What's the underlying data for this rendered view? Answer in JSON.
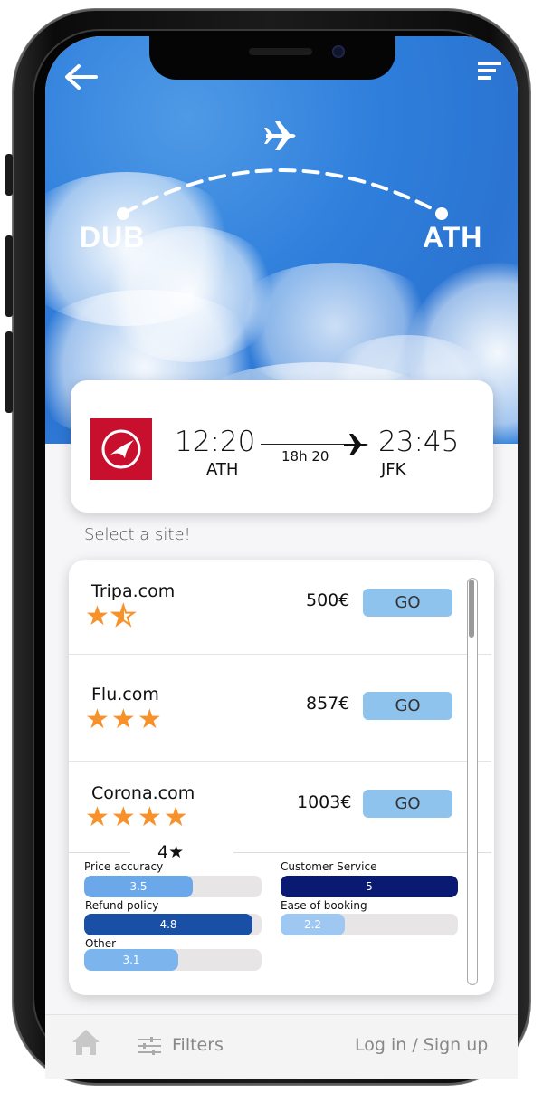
{
  "header": {
    "origin_code": "DUB",
    "destination_code": "ATH"
  },
  "flight": {
    "departure_time": "12:20",
    "departure_airport": "ATH",
    "duration": "18h 20",
    "arrival_time": "23:45",
    "arrival_airport": "JFK",
    "airline_color": "#c8102e"
  },
  "select_label": "Select a site!",
  "sites": [
    {
      "name": "Tripa.com",
      "price": "500€",
      "go_label": "GO",
      "rating": 1.5
    },
    {
      "name": "Flu.com",
      "price": "857€",
      "go_label": "GO",
      "rating": 3
    },
    {
      "name": "Corona.com",
      "price": "1003€",
      "go_label": "GO",
      "rating": 4
    }
  ],
  "rating_summary": {
    "score_text": "4★",
    "metrics": [
      {
        "label": "Price accuracy",
        "value": "3.5",
        "fraction": 0.61,
        "color": "#6aa8ea"
      },
      {
        "label": "Customer Service",
        "value": "5",
        "fraction": 1.0,
        "color": "#0a1a73"
      },
      {
        "label": "Refund policy",
        "value": "4.8",
        "fraction": 0.95,
        "color": "#1a4fa6"
      },
      {
        "label": "Ease of booking",
        "value": "2.2",
        "fraction": 0.36,
        "color": "#9ec8f2"
      },
      {
        "label": "Other",
        "value": "3.1",
        "fraction": 0.53,
        "color": "#7cb4ee"
      }
    ]
  },
  "bottom_nav": {
    "filters_label": "Filters",
    "login_label": "Log in / Sign up"
  },
  "colors": {
    "accent_star": "#f7922a",
    "go_button": "#8ec3ee",
    "sky": "#2f7fdc"
  }
}
